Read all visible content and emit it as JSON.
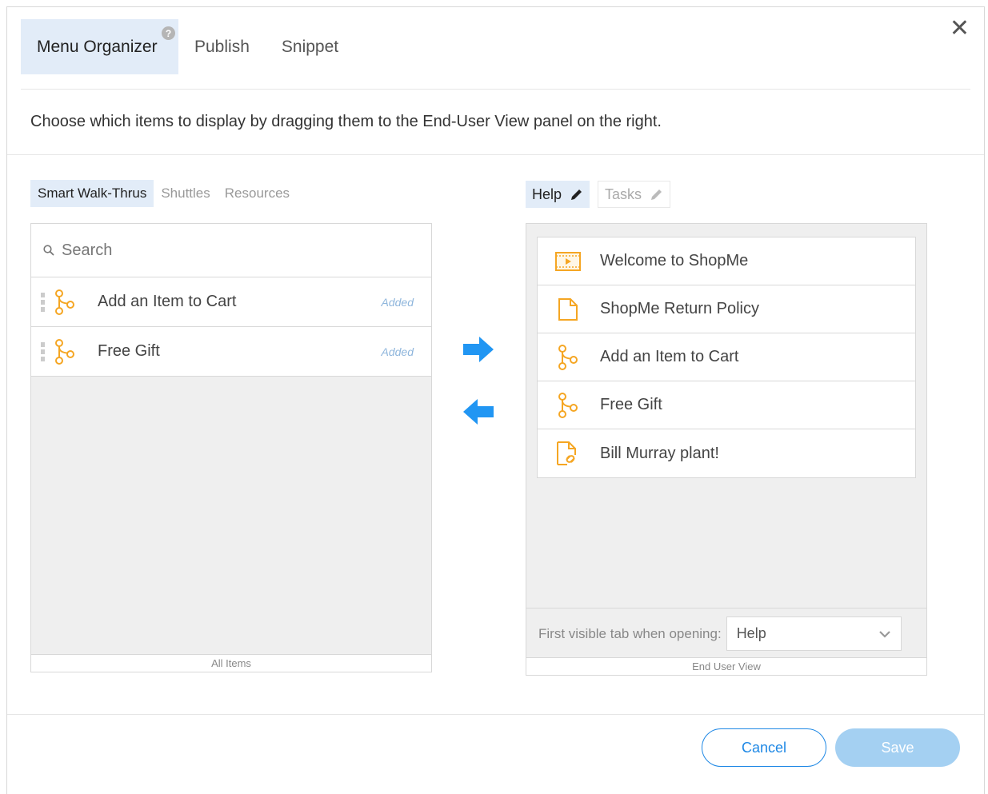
{
  "header": {
    "tabs": [
      {
        "label": "Menu Organizer",
        "active": true
      },
      {
        "label": "Publish",
        "active": false
      },
      {
        "label": "Snippet",
        "active": false
      }
    ],
    "help_glyph": "?",
    "close_glyph": "✕"
  },
  "instructions": "Choose which items to display by dragging them to the End-User View panel on the right.",
  "left_panel": {
    "tabs": [
      {
        "label": "Smart Walk-Thrus",
        "active": true
      },
      {
        "label": "Shuttles",
        "active": false
      },
      {
        "label": "Resources",
        "active": false
      }
    ],
    "search_placeholder": "Search",
    "items": [
      {
        "label": "Add an Item to Cart",
        "badge": "Added",
        "icon": "walkthru-icon"
      },
      {
        "label": "Free Gift",
        "badge": "Added",
        "icon": "walkthru-icon"
      }
    ],
    "footer": "All Items"
  },
  "right_panel": {
    "tabs": [
      {
        "label": "Help",
        "active": true,
        "icon": "pencil-icon"
      },
      {
        "label": "Tasks",
        "active": false,
        "icon": "pencil-icon"
      }
    ],
    "items": [
      {
        "label": "Welcome to ShopMe",
        "icon": "video-icon"
      },
      {
        "label": "ShopMe Return Policy",
        "icon": "document-icon"
      },
      {
        "label": "Add an Item to Cart",
        "icon": "walkthru-icon"
      },
      {
        "label": "Free Gift",
        "icon": "walkthru-icon"
      },
      {
        "label": "Bill Murray plant!",
        "icon": "link-document-icon"
      }
    ],
    "first_tab_label": "First visible tab when opening:",
    "first_tab_value": "Help",
    "footer": "End User View"
  },
  "footer": {
    "cancel_label": "Cancel",
    "save_label": "Save"
  },
  "colors": {
    "accent": "#1e88e5",
    "arrow": "#2196f3",
    "icon_orange": "#f5a623",
    "active_tab_bg": "#e2ecf8",
    "save_disabled": "#a4d0f2"
  }
}
